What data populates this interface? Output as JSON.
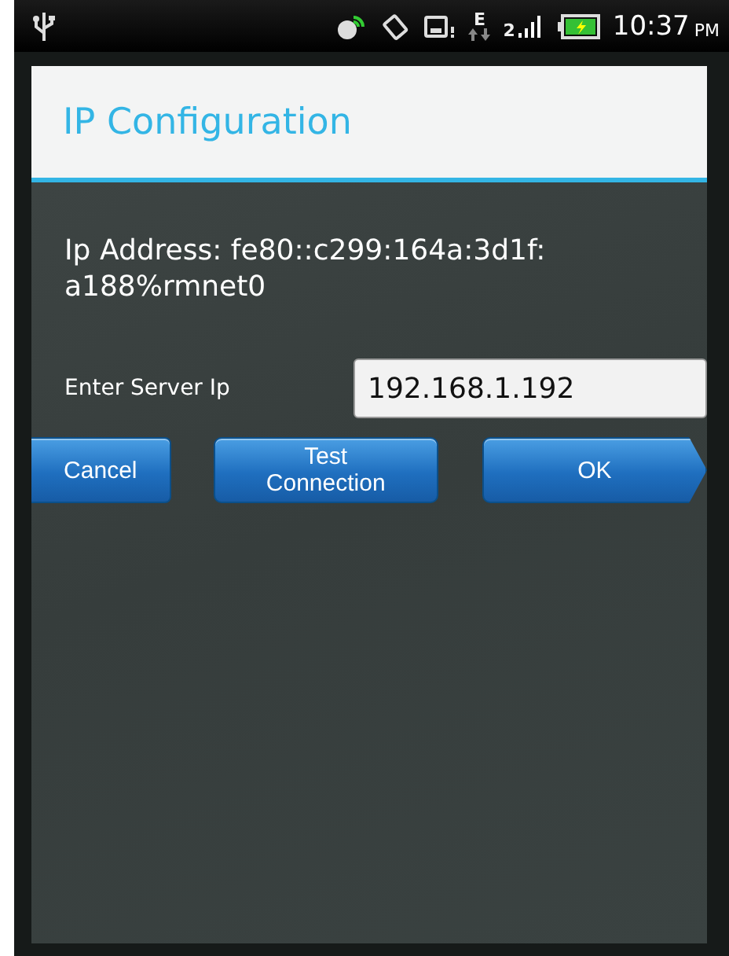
{
  "status_bar": {
    "network_type": "E",
    "sim_slot": "2",
    "time": "10:37",
    "meridiem": "PM"
  },
  "dialog": {
    "title": "IP Configuration",
    "ip_address": "Ip Address: fe80::c299:164a:3d1f:\na188%rmnet0",
    "server_label": "Enter Server Ip",
    "server_value": "192.168.1.192",
    "buttons": [
      {
        "label": "Cancel",
        "kind": "cut"
      },
      {
        "label": "Test\nConnection",
        "kind": "plain"
      },
      {
        "label": "OK",
        "kind": "arrow"
      }
    ]
  }
}
